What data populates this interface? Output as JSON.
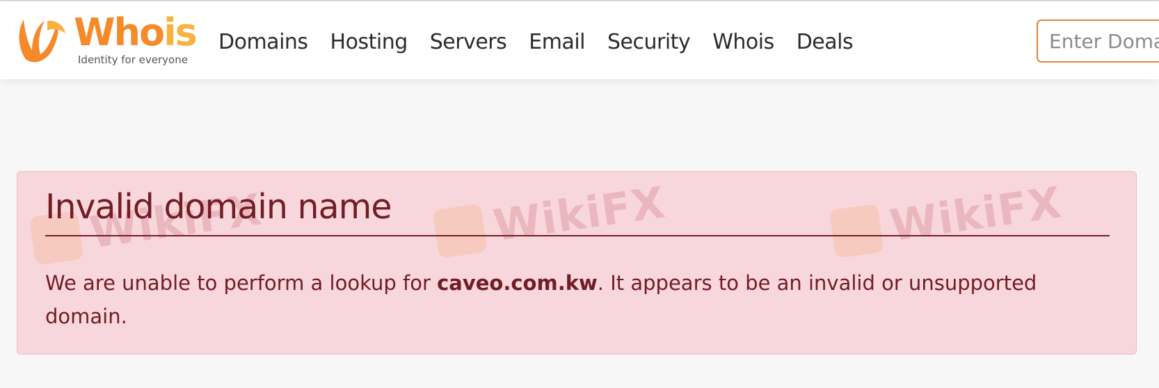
{
  "header": {
    "logo": {
      "wordmark_main": "Who",
      "wordmark_accent": "is",
      "tagline": "Identity for everyone"
    },
    "nav": [
      {
        "label": "Domains"
      },
      {
        "label": "Hosting"
      },
      {
        "label": "Servers"
      },
      {
        "label": "Email"
      },
      {
        "label": "Security"
      },
      {
        "label": "Whois"
      },
      {
        "label": "Deals"
      }
    ],
    "search": {
      "placeholder": "Enter Domain"
    }
  },
  "alert": {
    "title": "Invalid domain name",
    "message_prefix": "We are unable to perform a lookup for ",
    "domain": "caveo.com.kw",
    "message_suffix": ". It appears to be an invalid or unsupported domain."
  },
  "watermark": {
    "text": "WikiFX"
  },
  "colors": {
    "brand_orange": "#f58a2b",
    "brand_yellow": "#f9b13f",
    "alert_bg": "#f8d7dc",
    "alert_text": "#721c24",
    "search_border": "#e0823a"
  }
}
